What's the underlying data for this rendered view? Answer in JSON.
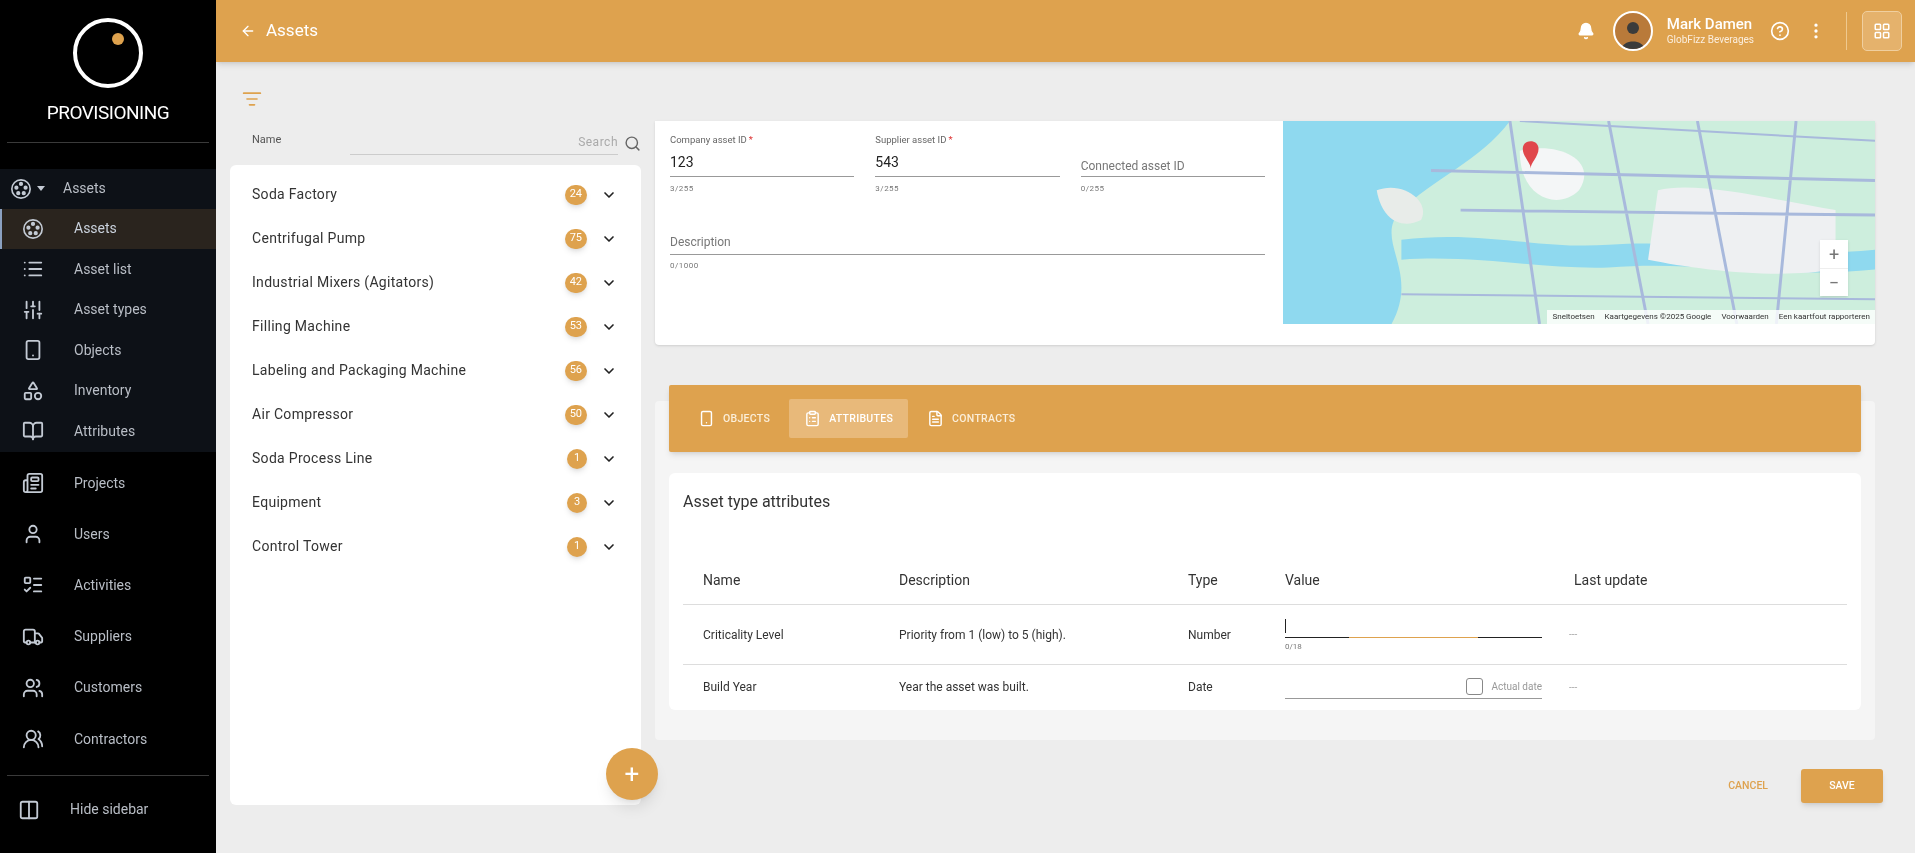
{
  "sidebar": {
    "logo_text": "PROVISIONING",
    "group": {
      "label": "Assets",
      "expanded": true,
      "items": [
        {
          "label": "Assets",
          "selected": true
        },
        {
          "label": "Asset list",
          "selected": false
        },
        {
          "label": "Asset types",
          "selected": false
        },
        {
          "label": "Objects",
          "selected": false
        },
        {
          "label": "Inventory",
          "selected": false
        },
        {
          "label": "Attributes",
          "selected": false
        }
      ]
    },
    "items": [
      {
        "label": "Projects",
        "selected": false
      },
      {
        "label": "Users",
        "selected": false
      },
      {
        "label": "Activities",
        "selected": false
      },
      {
        "label": "Suppliers",
        "selected": false
      },
      {
        "label": "Customers",
        "selected": false
      },
      {
        "label": "Contractors",
        "selected": false
      }
    ],
    "hide_button": "Hide sidebar"
  },
  "topbar": {
    "title": "Assets",
    "user": {
      "name": "Mark Damen",
      "company": "GlobFizz Beverages"
    }
  },
  "asset_list": {
    "column_label": "Name",
    "search": {
      "placeholder": "Search"
    },
    "items": [
      {
        "name": "Soda Factory",
        "count": "24",
        "expanded": false
      },
      {
        "name": "Centrifugal Pump",
        "count": "75",
        "expanded": false
      },
      {
        "name": "Industrial Mixers (Agitators)",
        "count": "42",
        "expanded": false
      },
      {
        "name": "Filling Machine",
        "count": "53",
        "expanded": false
      },
      {
        "name": "Labeling and Packaging Machine",
        "count": "56",
        "expanded": false
      },
      {
        "name": "Air Compressor",
        "count": "50",
        "expanded": false
      },
      {
        "name": "Soda Process Line",
        "count": "1",
        "expanded": false
      },
      {
        "name": "Equipment",
        "count": "3",
        "expanded": false
      },
      {
        "name": "Control Tower",
        "count": "1",
        "expanded": false
      }
    ],
    "add_button": "+"
  },
  "details": {
    "fields": [
      {
        "label": "Company asset ID",
        "required_mark": "*",
        "value": "123",
        "counter": "3/255"
      },
      {
        "label": "Supplier asset ID",
        "required_mark": "*",
        "value": "543",
        "counter": "3/255"
      },
      {
        "label": "Connected asset ID",
        "counter": "0/255"
      }
    ],
    "description": {
      "label": "Description",
      "counter": "0/1000"
    },
    "map": {
      "zoom_in": "+",
      "zoom_out": "−",
      "attribution": [
        "Sneltoetsen",
        "Kaartgegevens ©2025 Google",
        "Voorwaarden",
        "Een kaartfout rapporteren"
      ]
    }
  },
  "tabs": [
    {
      "label": "OBJECTS",
      "selected": false
    },
    {
      "label": "ATTRIBUTES",
      "selected": true
    },
    {
      "label": "CONTRACTS",
      "selected": false
    }
  ],
  "attributes": {
    "title": "Asset type attributes",
    "columns": [
      "Name",
      "Description",
      "Type",
      "Value",
      "Last update"
    ],
    "rows": [
      {
        "kind": "number",
        "name": "Criticality Level",
        "description": "Priority from 1 (low) to 5 (high).",
        "type": "Number",
        "focused": true,
        "counter": "0/18",
        "last_update": "---"
      },
      {
        "kind": "date",
        "name": "Build Year",
        "description": "Year the asset was built.",
        "type": "Date",
        "checkbox_label": "Actual date",
        "checked": false,
        "last_update": "---"
      }
    ]
  },
  "actions": {
    "cancel": "CANCEL",
    "save": "SAVE"
  }
}
